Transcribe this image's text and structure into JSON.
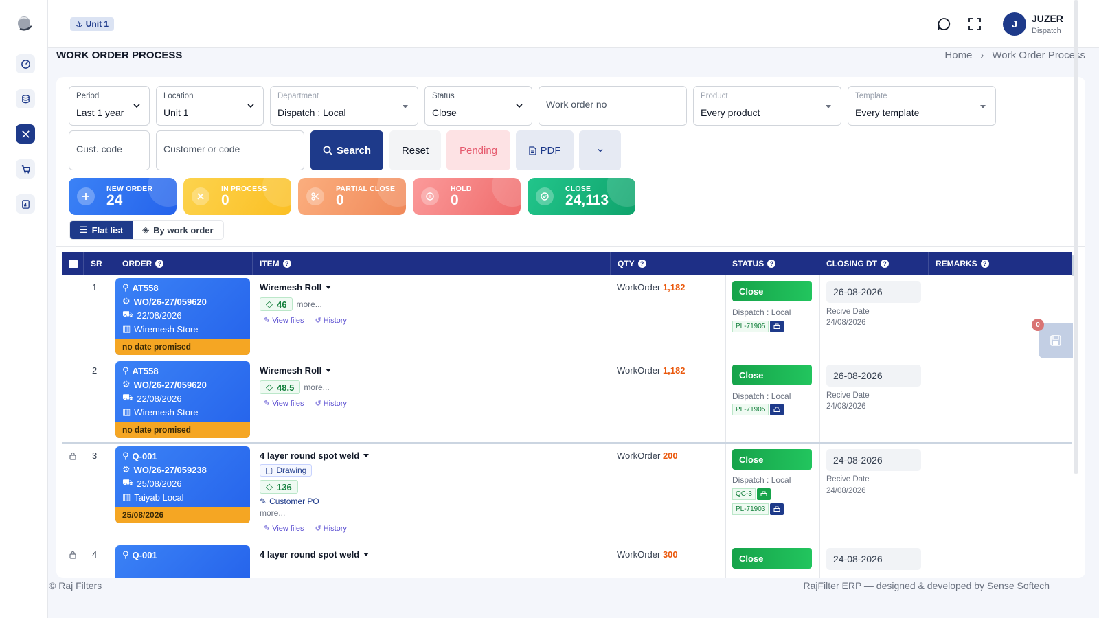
{
  "topbar": {
    "unit_chip": "Unit 1",
    "user_initial": "J",
    "user_name": "JUZER",
    "user_role": "Dispatch"
  },
  "page": {
    "title": "WORK ORDER PROCESS",
    "breadcrumb": [
      "Home",
      "Work Order Process"
    ]
  },
  "filters": {
    "period": {
      "label": "Period",
      "value": "Last 1 year"
    },
    "location": {
      "label": "Location",
      "value": "Unit 1"
    },
    "department": {
      "label": "Department",
      "value": "Dispatch : Local"
    },
    "status": {
      "label": "Status",
      "value": "Close"
    },
    "work_order_no": {
      "placeholder": "Work order no"
    },
    "product": {
      "label": "Product",
      "value": "Every product"
    },
    "template": {
      "label": "Template",
      "value": "Every template"
    },
    "cust_code": {
      "placeholder": "Cust. code"
    },
    "customer": {
      "placeholder": "Customer or code"
    }
  },
  "buttons": {
    "search": "Search",
    "reset": "Reset",
    "pending": "Pending",
    "pdf": "PDF"
  },
  "stats": [
    {
      "label": "NEW ORDER",
      "value": "24",
      "color": "#3b82f6"
    },
    {
      "label": "IN PROCESS",
      "value": "0",
      "color": "#fbbf24"
    },
    {
      "label": "PARTIAL CLOSE",
      "value": "0",
      "color": "#f59e6b"
    },
    {
      "label": "HOLD",
      "value": "0",
      "color": "#f87171"
    },
    {
      "label": "CLOSE",
      "value": "24,113",
      "color": "#10b981"
    }
  ],
  "view_tabs": {
    "flat": "Flat list",
    "by_order": "By work order"
  },
  "table": {
    "headers": {
      "sr": "SR",
      "order": "ORDER",
      "item": "ITEM",
      "qty": "QTY",
      "status": "STATUS",
      "closing_dt": "CLOSING DT",
      "remarks": "REMARKS"
    },
    "rows": [
      {
        "sr": "1",
        "customer": "AT558",
        "wo": "WO/26-27/059620",
        "date": "22/08/2026",
        "store": "Wiremesh Store",
        "promise": "no date promised",
        "item": "Wiremesh Roll",
        "price": "46",
        "more": "more...",
        "view_files": "View files",
        "history": "History",
        "qty_label": "WorkOrder",
        "qty": "1,182",
        "status": "Close",
        "dept": "Dispatch : Local",
        "tag1": "PL-71905",
        "closing": "26-08-2026",
        "recv_label": "Recive Date",
        "recv_date": "24/08/2026"
      },
      {
        "sr": "2",
        "customer": "AT558",
        "wo": "WO/26-27/059620",
        "date": "22/08/2026",
        "store": "Wiremesh Store",
        "promise": "no date promised",
        "item": "Wiremesh Roll",
        "price": "48.5",
        "more": "more...",
        "view_files": "View files",
        "history": "History",
        "qty_label": "WorkOrder",
        "qty": "1,182",
        "status": "Close",
        "dept": "Dispatch : Local",
        "tag1": "PL-71905",
        "closing": "26-08-2026",
        "recv_label": "Recive Date",
        "recv_date": "24/08/2026"
      },
      {
        "sr": "3",
        "customer": "Q-001",
        "wo": "WO/26-27/059238",
        "date": "25/08/2026",
        "store": "Taiyab Local",
        "promise": "25/08/2026",
        "item": "4 layer round spot weld",
        "drawing": "Drawing",
        "price": "136",
        "custpo": "Customer PO",
        "more": "more...",
        "view_files": "View files",
        "history": "History",
        "qty_label": "WorkOrder",
        "qty": "200",
        "status": "Close",
        "dept": "Dispatch : Local",
        "tag0": "QC-3",
        "tag1": "PL-71903",
        "closing": "24-08-2026",
        "recv_label": "Recive Date",
        "recv_date": "24/08/2026"
      },
      {
        "sr": "4",
        "customer": "Q-001",
        "item": "4 layer round spot weld",
        "qty_label": "WorkOrder",
        "qty": "300",
        "status": "Close",
        "closing": "24-08-2026"
      }
    ]
  },
  "float": {
    "badge": "0"
  },
  "footer": {
    "left": "© Raj Filters",
    "right": "RajFilter ERP — designed & developed by Sense Softech"
  }
}
